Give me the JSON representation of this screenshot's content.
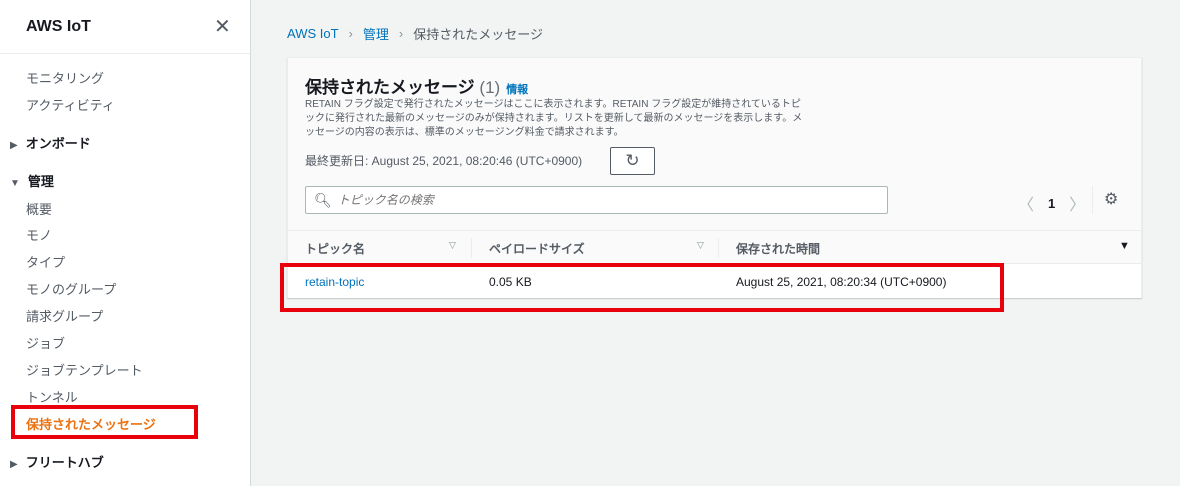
{
  "sidebar": {
    "title": "AWS IoT",
    "items": {
      "monitoring": "モニタリング",
      "activity": "アクティビティ",
      "onboard": "オンボード",
      "manage": "管理",
      "overview": "概要",
      "things": "モノ",
      "types": "タイプ",
      "thing_groups": "モノのグループ",
      "billing_groups": "請求グループ",
      "jobs": "ジョブ",
      "job_templates": "ジョブテンプレート",
      "tunnels": "トンネル",
      "retained_messages": "保持されたメッセージ",
      "fleet_hub": "フリートハブ"
    }
  },
  "breadcrumb": [
    "AWS IoT",
    "管理",
    "保持されたメッセージ"
  ],
  "panel": {
    "title": "保持されたメッセージ",
    "count": "(1)",
    "info": "情報",
    "description": "RETAIN フラグ設定で発行されたメッセージはここに表示されます。RETAIN フラグ設定が維持されているトピックに発行された最新のメッセージのみが保持されます。リストを更新して最新のメッセージを表示します。メッセージの内容の表示は、標準のメッセージング料金で請求されます。",
    "last_updated": "最終更新日: August 25, 2021, 08:20:46 (UTC+0900)",
    "search_placeholder": "トピック名の検索",
    "page": "1"
  },
  "table": {
    "columns": [
      "トピック名",
      "ペイロードサイズ",
      "保存された時間"
    ],
    "rows": [
      {
        "topic": "retain-topic",
        "size": "0.05 KB",
        "time": "August 25, 2021, 08:20:34 (UTC+0900)"
      }
    ]
  },
  "colors": {
    "accent": "#ec7211",
    "link": "#0073bb",
    "highlight": "#e8000b"
  }
}
